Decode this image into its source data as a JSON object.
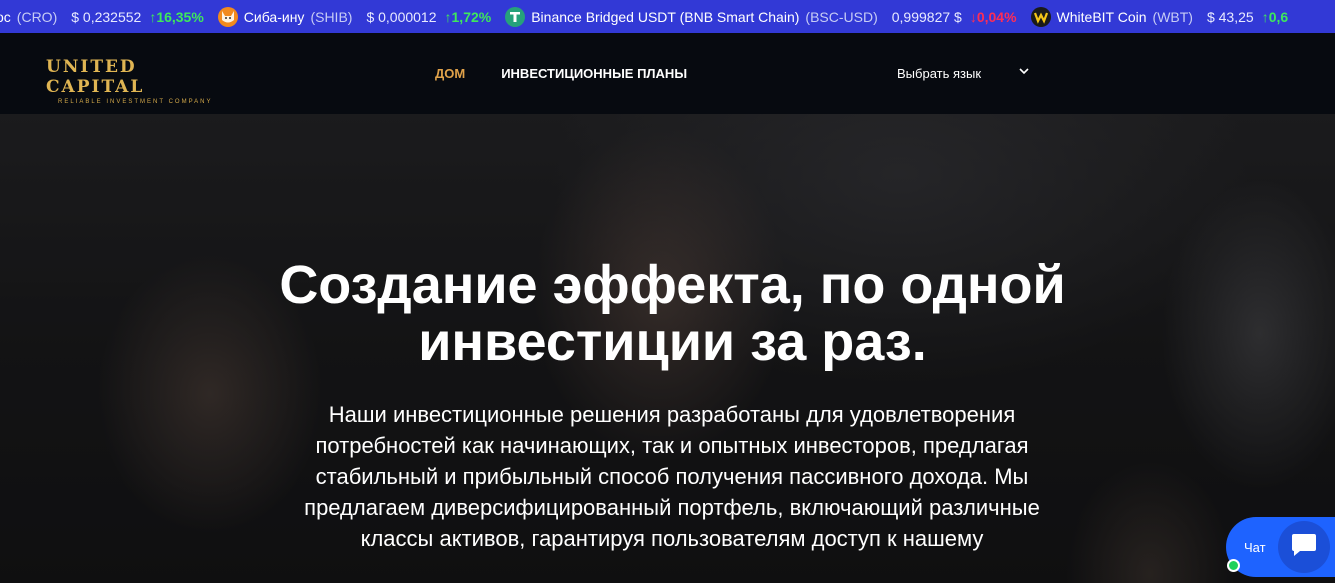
{
  "ticker": {
    "items": [
      {
        "name": "ос",
        "symbol": "(CRO)",
        "price": "$ 0,232552",
        "change": "↑16,35%",
        "dir": "up",
        "icon": "",
        "icon_color": ""
      },
      {
        "name": "Сиба-ину",
        "symbol": "(SHIB)",
        "price": "$ 0,000012",
        "change": "↑1,72%",
        "dir": "up",
        "icon": "shib-icon",
        "icon_color": "#f28a1d"
      },
      {
        "name": "Binance Bridged USDT (BNB Smart Chain)",
        "symbol": "(BSC-USD)",
        "price": "0,999827 $",
        "change": "↓0,04%",
        "dir": "down",
        "icon": "tether-icon",
        "icon_color": "#26a17b"
      },
      {
        "name": "WhiteBIT Coin",
        "symbol": "(WBT)",
        "price": "$ 43,25",
        "change": "↑0,6",
        "dir": "up",
        "icon": "whitebit-icon",
        "icon_color": "#1a1a1a"
      }
    ]
  },
  "header": {
    "logo_main": "UNITED CAPITAL",
    "logo_sub": "RELIABLE INVESTMENT COMPANY",
    "nav": [
      {
        "label": "ДОМ",
        "active": true
      },
      {
        "label": "ИНВЕСТИЦИОННЫЕ ПЛАНЫ",
        "active": false
      }
    ],
    "language_select": "Выбрать язык"
  },
  "hero": {
    "title": "Создание эффекта, по одной инвестиции за раз.",
    "text": "Наши инвестиционные решения разработаны для удовлетворения потребностей как начинающих, так и опытных инвесторов, предлагая стабильный и прибыльный способ получения пассивного дохода. Мы предлагаем диверсифицированный портфель, включающий различные классы активов, гарантируя пользователям доступ к нашему"
  },
  "chat": {
    "label": "Чат",
    "icon": "chat-bubble-icon"
  },
  "colors": {
    "ticker_bg": "#3239d6",
    "accent_gold": "#e0a24a",
    "chat_blue": "#1e63ff"
  }
}
